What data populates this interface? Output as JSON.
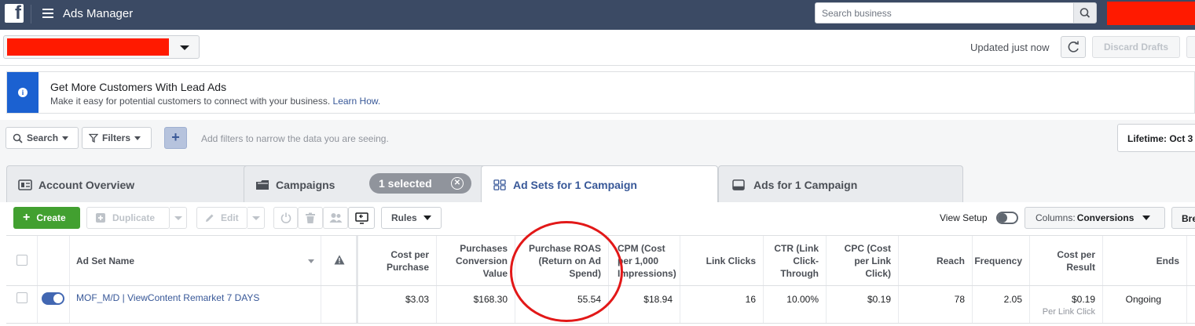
{
  "topbar": {
    "logo": "f",
    "title": "Ads Manager",
    "search_placeholder": "Search business",
    "search_icon": "search-icon"
  },
  "account_bar": {
    "updated_text": "Updated just now",
    "discard_label": "Discard Drafts"
  },
  "banner": {
    "title": "Get More Customers With Lead Ads",
    "description": "Make it easy for potential customers to connect with your business.",
    "link": "Learn How.",
    "icon_text": "i"
  },
  "filter_bar": {
    "search_label": "Search",
    "filters_label": "Filters",
    "plus_label": "+",
    "hint": "Add filters to narrow the data you are seeing.",
    "date_range": "Lifetime: Oct 3"
  },
  "tabs": [
    {
      "label": "Account Overview",
      "icon": "account-overview-icon"
    },
    {
      "label": "Campaigns",
      "icon": "folder-icon",
      "selected_label": "1 selected"
    },
    {
      "label": "Ad Sets for 1 Campaign",
      "icon": "ad-sets-grid-icon",
      "active": true
    },
    {
      "label": "Ads for 1 Campaign",
      "icon": "ads-icon"
    }
  ],
  "toolbar": {
    "create_label": "Create",
    "duplicate_label": "Duplicate",
    "edit_label": "Edit",
    "rules_label": "Rules",
    "view_setup_label": "View Setup",
    "columns_prefix": "Columns:",
    "columns_value": "Conversions",
    "breakdown_label": "Bre"
  },
  "table": {
    "headers": {
      "name": "Ad Set Name",
      "cost_per_purchase": "Cost per Purchase",
      "purchases_conversion_value": "Purchases Conversion Value",
      "purchase_roas": "Purchase ROAS (Return on Ad Spend)",
      "cpm": "CPM (Cost per 1,000 Impressions)",
      "link_clicks": "Link Clicks",
      "ctr": "CTR (Link Click-Through",
      "cpc": "CPC (Cost per Link Click)",
      "reach": "Reach",
      "frequency": "Frequency",
      "cost_per_result": "Cost per Result",
      "ends": "Ends"
    },
    "rows": [
      {
        "name": "MOF_M/D | ViewContent Remarket 7 DAYS",
        "cost_per_purchase": "$3.03",
        "purchases_conversion_value": "$168.30",
        "purchase_roas": "55.54",
        "cpm": "$18.94",
        "link_clicks": "16",
        "ctr": "10.00%",
        "cpc": "$0.19",
        "reach": "78",
        "frequency": "2.05",
        "cost_per_result": "$0.19",
        "cost_per_result_sub": "Per Link Click",
        "ends": "Ongoing"
      }
    ]
  },
  "colors": {
    "topbar": "#3b4a64",
    "create_green": "#42a030",
    "link_blue": "#385898",
    "annotation_red": "#e21818",
    "redaction_red": "#ff1a00"
  }
}
